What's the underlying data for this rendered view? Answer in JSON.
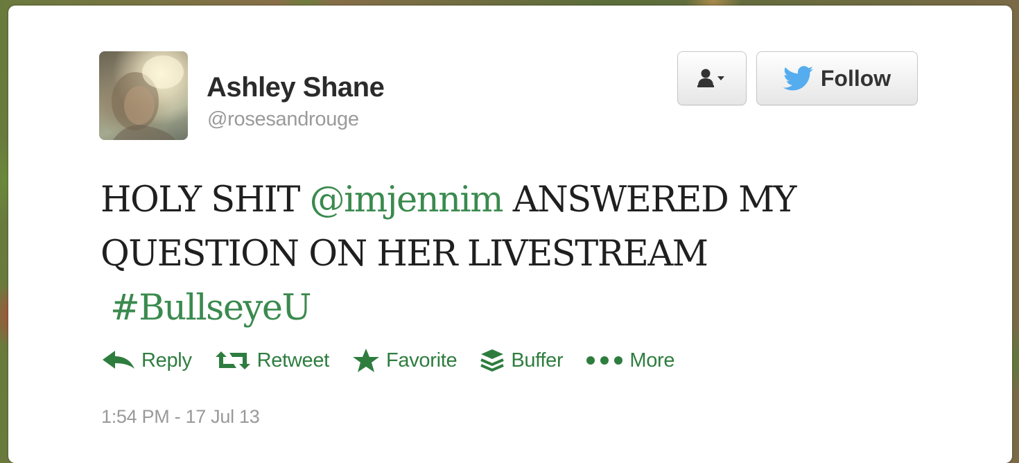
{
  "tweet": {
    "author": {
      "display_name": "Ashley Shane",
      "handle": "@rosesandrouge"
    },
    "text": {
      "part1": "HOLY SHIT ",
      "mention": "@imjennim",
      "part2": " ANSWERED MY QUESTION ON HER LIVESTREAM",
      "hashtag": "#BullseyeU"
    },
    "timestamp": "1:54 PM - 17 Jul 13"
  },
  "buttons": {
    "user_menu_icon": "user-dropdown-icon",
    "follow_label": "Follow"
  },
  "actions": [
    {
      "label": "Reply",
      "icon": "reply-icon"
    },
    {
      "label": "Retweet",
      "icon": "retweet-icon"
    },
    {
      "label": "Favorite",
      "icon": "star-icon"
    },
    {
      "label": "Buffer",
      "icon": "buffer-icon"
    },
    {
      "label": "More",
      "icon": "more-dots-icon"
    }
  ],
  "colors": {
    "link": "#3a8a4e",
    "action": "#2e7d3f",
    "twitter_bird": "#55acee"
  }
}
